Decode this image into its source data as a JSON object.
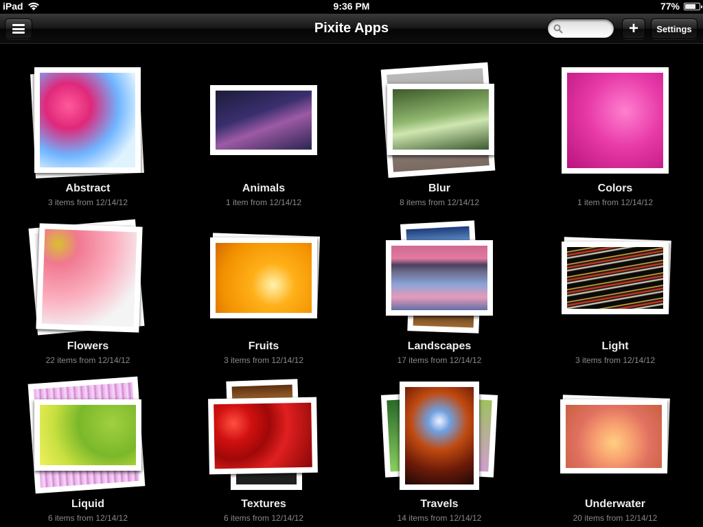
{
  "status": {
    "device": "iPad",
    "time": "9:36 PM",
    "battery": "77%",
    "battery_level": 0.77
  },
  "nav": {
    "title": "Pixite Apps",
    "search_placeholder": "",
    "add_label": "+",
    "settings_label": "Settings"
  },
  "albums": [
    {
      "name": "Abstract",
      "info": "3 items from 12/14/12"
    },
    {
      "name": "Animals",
      "info": "1 item from 12/14/12"
    },
    {
      "name": "Blur",
      "info": "8 items from 12/14/12"
    },
    {
      "name": "Colors",
      "info": "1 item from 12/14/12"
    },
    {
      "name": "Flowers",
      "info": "22 items from 12/14/12"
    },
    {
      "name": "Fruits",
      "info": "3 items from 12/14/12"
    },
    {
      "name": "Landscapes",
      "info": "17 items from 12/14/12"
    },
    {
      "name": "Light",
      "info": "3 items from 12/14/12"
    },
    {
      "name": "Liquid",
      "info": "6 items from 12/14/12"
    },
    {
      "name": "Textures",
      "info": "6 items from 12/14/12"
    },
    {
      "name": "Travels",
      "info": "14 items from 12/14/12"
    },
    {
      "name": "Underwater",
      "info": "20 items from 12/14/12"
    }
  ]
}
